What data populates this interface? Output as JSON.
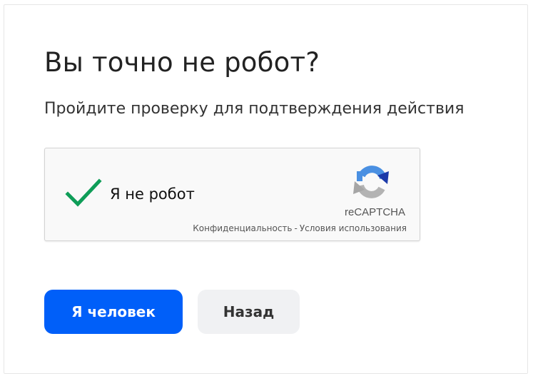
{
  "page": {
    "title": "Вы точно не робот?",
    "subtitle": "Пройдите проверку для подтверждения действия"
  },
  "captcha": {
    "checked": true,
    "label": "Я не робот",
    "brand": "reCAPTCHA",
    "privacy_link": "Конфиденциальность",
    "separator": "-",
    "terms_link": "Условия использования",
    "check_color": "#0f9d58"
  },
  "actions": {
    "primary_label": "Я человек",
    "secondary_label": "Назад",
    "primary_color": "#005ff9",
    "secondary_color": "#f0f1f3"
  }
}
